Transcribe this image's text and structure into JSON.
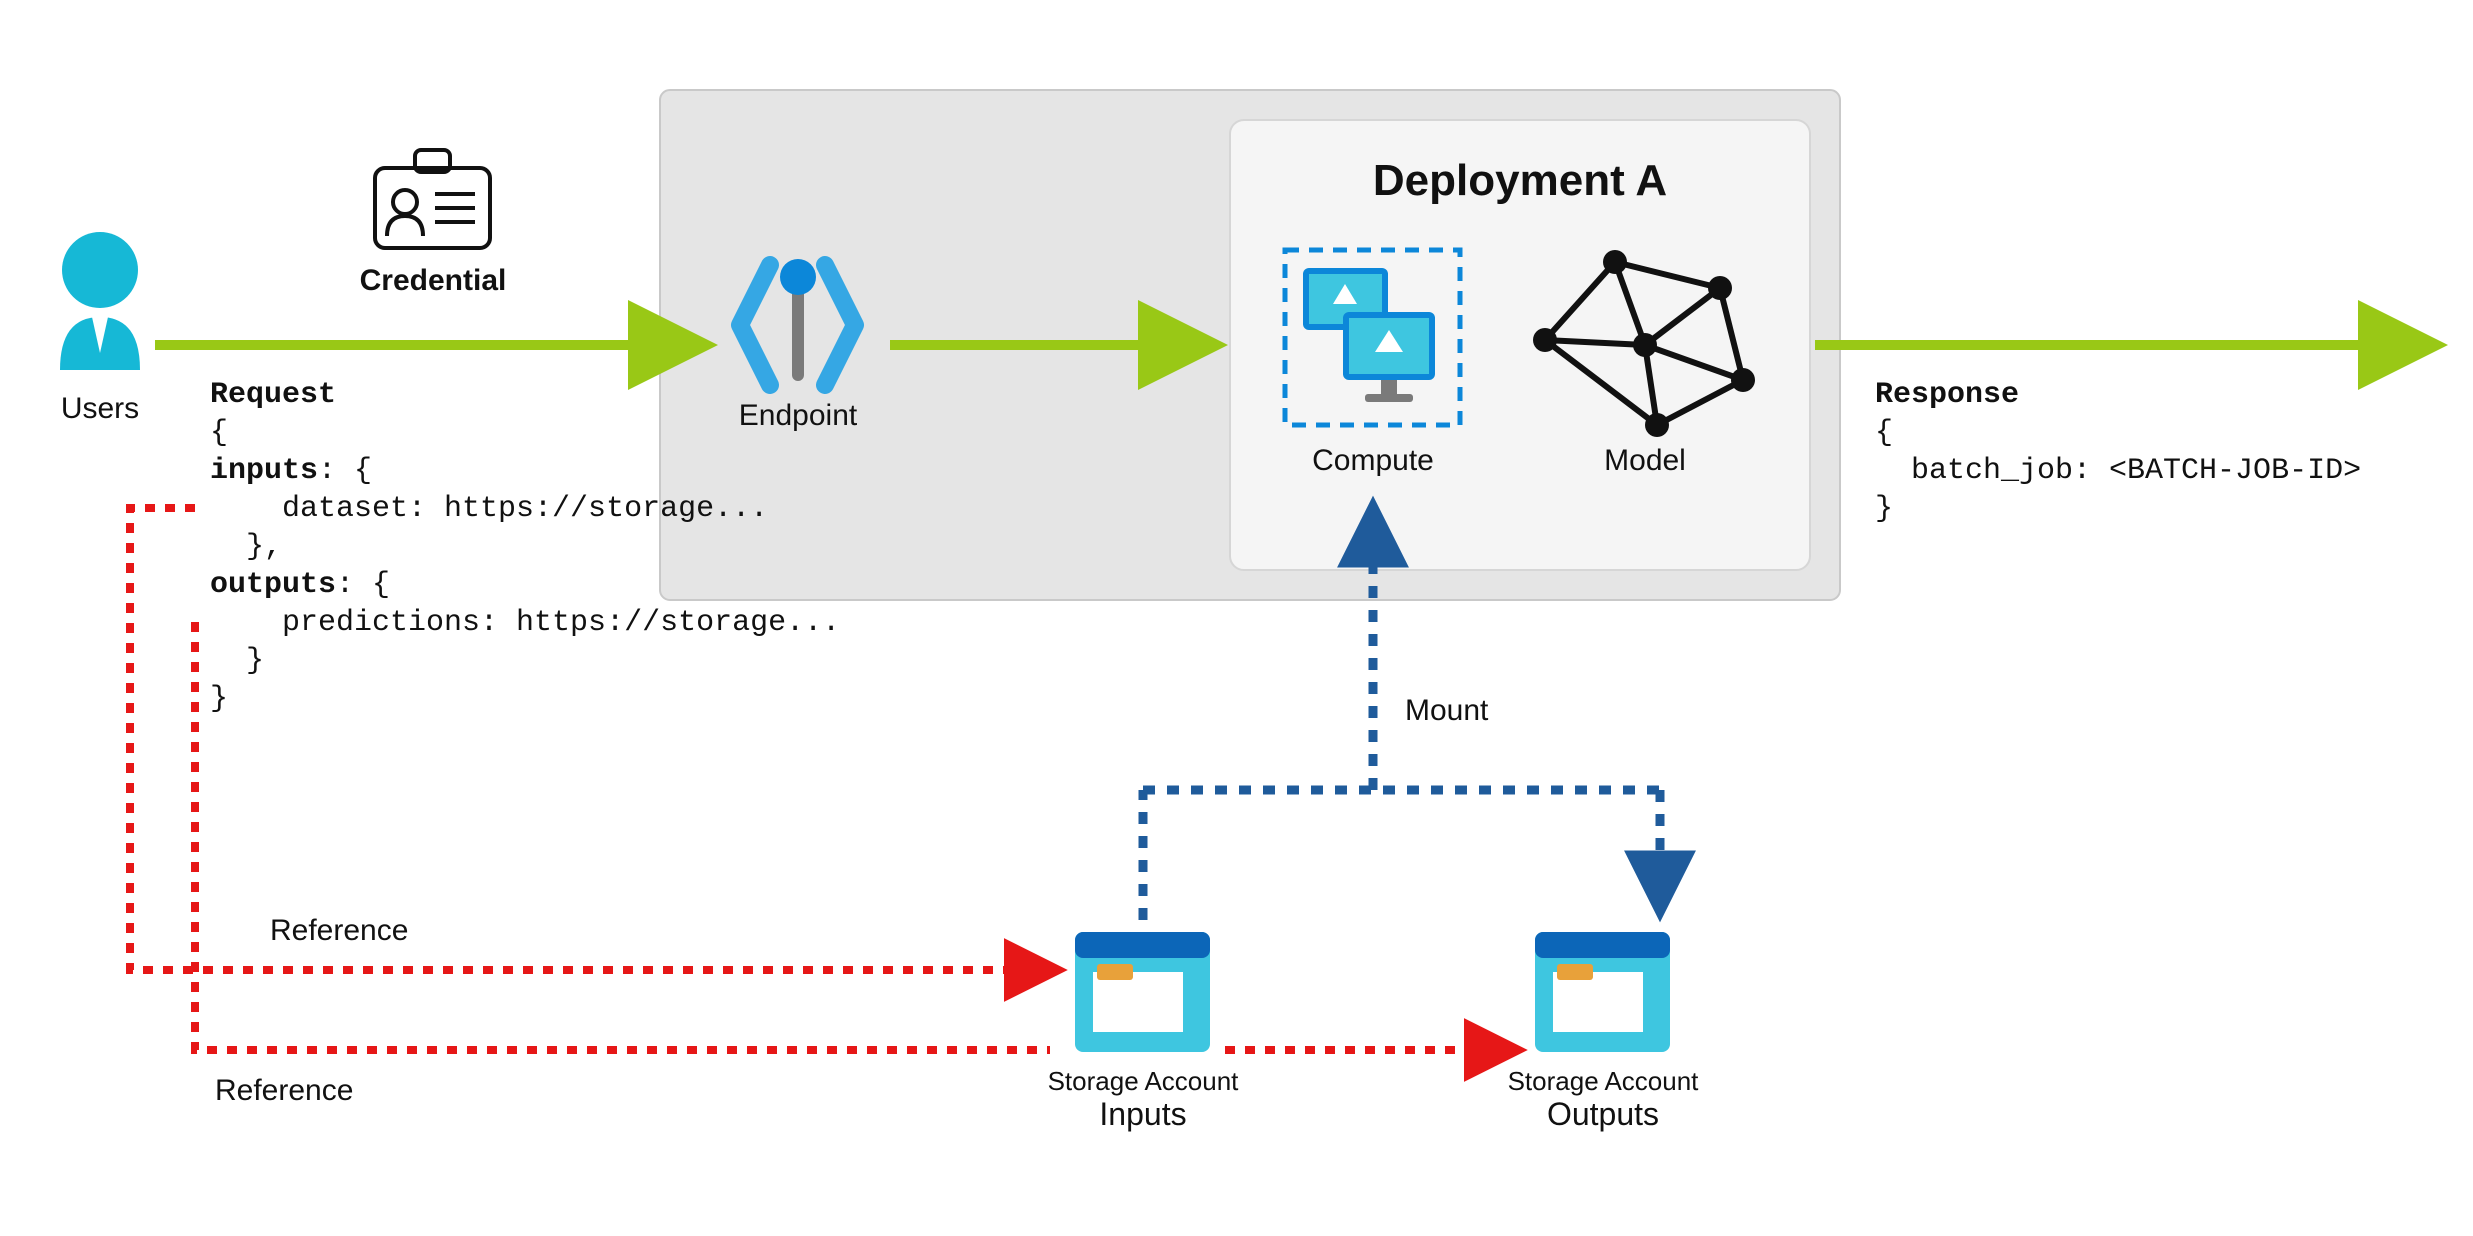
{
  "users": {
    "label": "Users"
  },
  "credential": {
    "label": "Credential"
  },
  "request": {
    "title": "Request",
    "line1": "{",
    "line2": "  inputs: {",
    "line3": "    dataset: https://storage...",
    "line4": "  },",
    "line5": "  outputs: {",
    "line6": "    predictions: https://storage...",
    "line7": "  }",
    "line8": "}"
  },
  "endpoint": {
    "label": "Endpoint"
  },
  "deployment": {
    "title": "Deployment A",
    "compute": "Compute",
    "model": "Model"
  },
  "response": {
    "title": "Response",
    "line1": "{",
    "line2": "  batch_job: <BATCH-JOB-ID>",
    "line3": "}"
  },
  "mount": {
    "label": "Mount"
  },
  "reference1": {
    "label": "Reference"
  },
  "reference2": {
    "label": "Reference"
  },
  "storage_inputs": {
    "label": "Storage Account",
    "sub": "Inputs"
  },
  "storage_outputs": {
    "label": "Storage Account",
    "sub": "Outputs"
  },
  "colors": {
    "green": "#99C816",
    "teal": "#00B0CF",
    "red": "#E61717",
    "navy": "#1F5B9B",
    "blue": "#0C87D9",
    "lightblue": "#3EC6E0",
    "boxFill": "#E5E5E5",
    "boxStroke": "#C9C9C9",
    "innerFill": "#F5F5F5",
    "innerStroke": "#D6D6D6"
  }
}
